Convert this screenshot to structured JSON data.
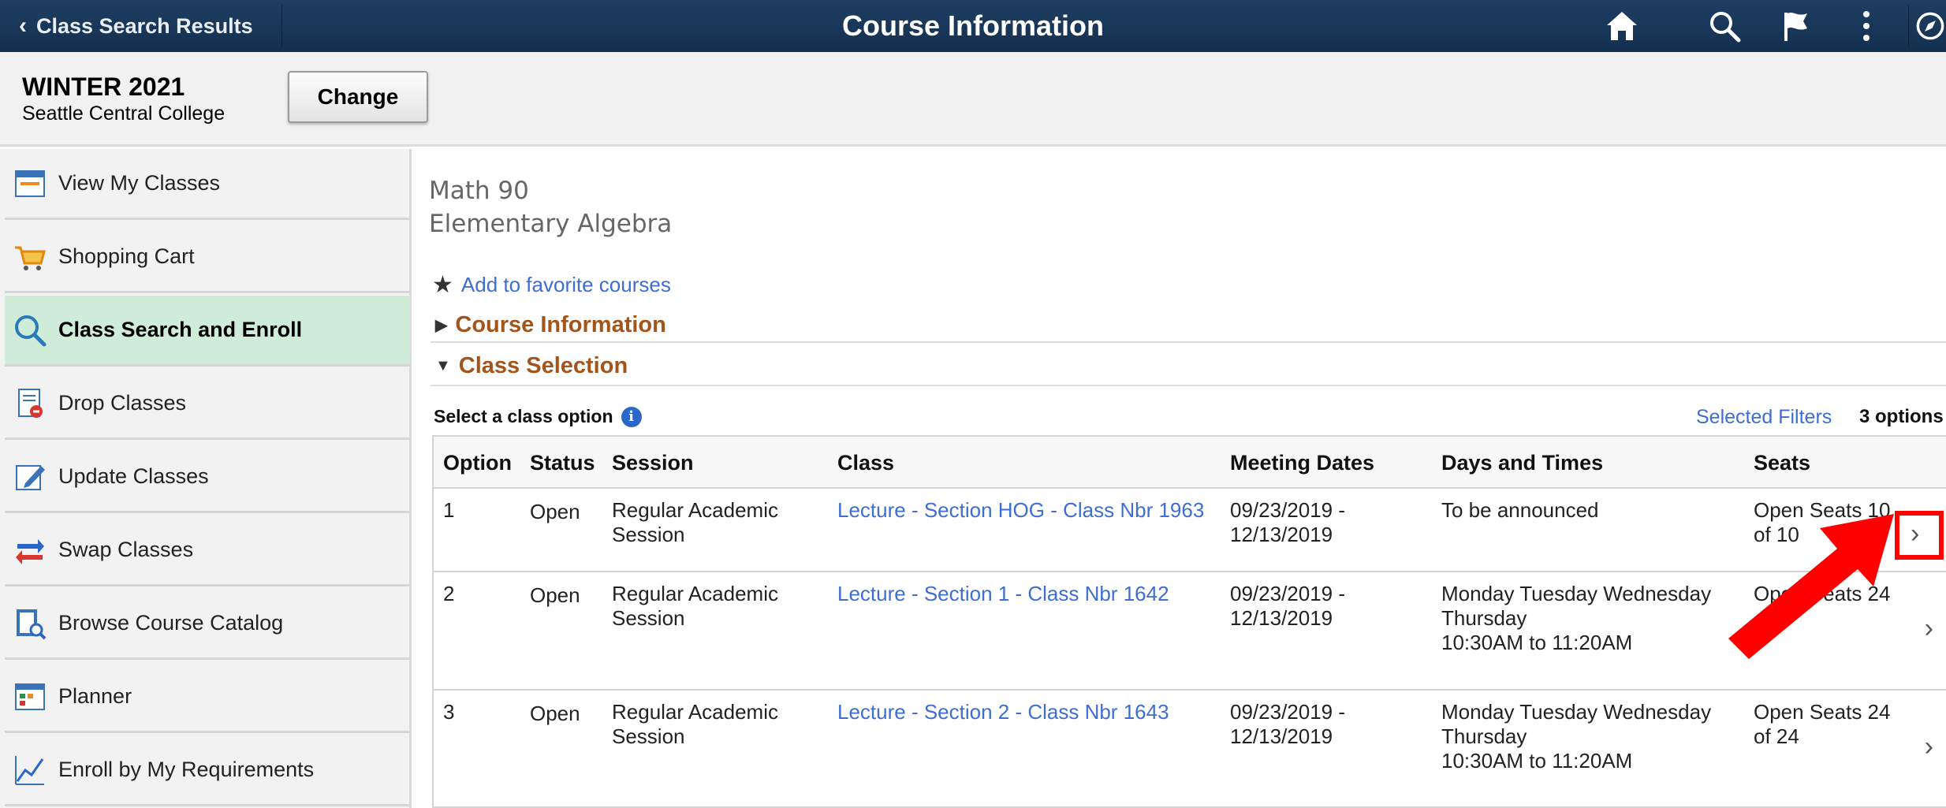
{
  "header": {
    "back_label": "Class Search Results",
    "title": "Course Information",
    "icons": [
      "home-icon",
      "search-icon",
      "flag-icon",
      "more-vertical-icon",
      "compass-icon"
    ]
  },
  "term": {
    "name": "WINTER 2021",
    "college": "Seattle Central College",
    "change_label": "Change"
  },
  "sidebar": {
    "items": [
      {
        "label": "View My Classes",
        "icon": "calendar-icon"
      },
      {
        "label": "Shopping Cart",
        "icon": "cart-icon"
      },
      {
        "label": "Class Search and Enroll",
        "icon": "search-icon",
        "active": true
      },
      {
        "label": "Drop Classes",
        "icon": "drop-icon"
      },
      {
        "label": "Update Classes",
        "icon": "edit-icon"
      },
      {
        "label": "Swap Classes",
        "icon": "swap-icon"
      },
      {
        "label": "Browse Course Catalog",
        "icon": "catalog-icon"
      },
      {
        "label": "Planner",
        "icon": "planner-icon"
      },
      {
        "label": "Enroll by My Requirements",
        "icon": "chart-icon"
      }
    ]
  },
  "course": {
    "code": "Math 90",
    "name": "Elementary Algebra",
    "favorite_label": "Add to favorite courses",
    "sections": {
      "info": "Course Information",
      "selection": "Class Selection"
    }
  },
  "class_selection": {
    "label": "Select a class option",
    "filters_label": "Selected Filters",
    "options_count": "3 options",
    "columns": [
      "Option",
      "Status",
      "Session",
      "Class",
      "Meeting Dates",
      "Days and Times",
      "Seats"
    ],
    "rows": [
      {
        "option": "1",
        "status": "Open",
        "session": [
          "Regular Academic",
          "Session"
        ],
        "class": "Lecture - Section HOG - Class Nbr 1963",
        "dates": [
          "09/23/2019 -",
          "12/13/2019"
        ],
        "times": [
          "To be announced"
        ],
        "seats": [
          "Open Seats 10",
          "of 10"
        ]
      },
      {
        "option": "2",
        "status": "Open",
        "session": [
          "Regular Academic",
          "Session"
        ],
        "class": "Lecture - Section 1 - Class Nbr 1642",
        "dates": [
          "09/23/2019 -",
          "12/13/2019"
        ],
        "times": [
          "Monday Tuesday Wednesday",
          "Thursday",
          "10:30AM to 11:20AM"
        ],
        "seats": [
          "Open Seats 24",
          ""
        ]
      },
      {
        "option": "3",
        "status": "Open",
        "session": [
          "Regular Academic",
          "Session"
        ],
        "class": "Lecture - Section 2 - Class Nbr 1643",
        "dates": [
          "09/23/2019 -",
          "12/13/2019"
        ],
        "times": [
          "Monday Tuesday Wednesday",
          "Thursday",
          "10:30AM to 11:20AM"
        ],
        "seats": [
          "Open Seats 24",
          "of 24"
        ]
      }
    ]
  },
  "colors": {
    "header_bg": "#1a3a5c",
    "active_nav": "#cfecd8",
    "link": "#3d6ed3",
    "section_title": "#a3541b",
    "annotation": "#ff0000"
  }
}
